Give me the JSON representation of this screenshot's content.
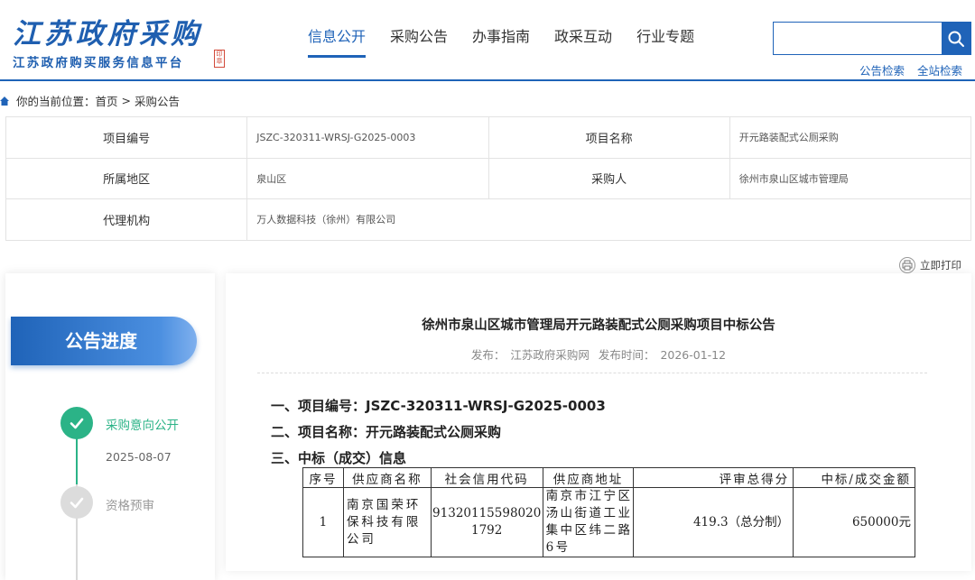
{
  "logo": {
    "calligraphy": "江苏政府采购",
    "subtitle": "江苏政府购买服务信息平台",
    "seal": "印章"
  },
  "nav": [
    "信息公开",
    "采购公告",
    "办事指南",
    "政采互动",
    "行业专题"
  ],
  "search": {
    "placeholder": "",
    "links": [
      "公告检索",
      "全站检索"
    ]
  },
  "breadcrumb": {
    "prefix": "你的当前位置：",
    "home": "首页",
    "separator": ">",
    "current": "采购公告"
  },
  "info": {
    "rows": [
      [
        {
          "label": "项目编号",
          "value": "JSZC-320311-WRSJ-G2025-0003"
        },
        {
          "label": "项目名称",
          "value": "开元路装配式公厕采购"
        }
      ],
      [
        {
          "label": "所属地区",
          "value": "泉山区"
        },
        {
          "label": "采购人",
          "value": "徐州市泉山区城市管理局"
        }
      ],
      [
        {
          "label": "代理机构",
          "value": "万人数据科技（徐州）有限公司"
        }
      ]
    ]
  },
  "print_label": "立即打印",
  "sidebar": {
    "title": "公告进度",
    "steps": [
      {
        "label": "采购意向公开",
        "date": "2025-08-07",
        "done": true,
        "color": "#2bb387"
      },
      {
        "label": "资格预审",
        "date": "",
        "done": false,
        "color": "#999999"
      }
    ]
  },
  "document": {
    "title": "徐州市泉山区城市管理局开元路装配式公厕采购项目中标公告",
    "publisher_label": "发布：",
    "publisher": "江苏政府采购网",
    "time_label": "发布时间：",
    "time": "2026-01-12",
    "sections": [
      "一、项目编号：JSZC-320311-WRSJ-G2025-0003",
      "二、项目名称：开元路装配式公厕采购",
      "三、中标（成交）信息"
    ],
    "table": {
      "headers": [
        "序号",
        "供应商名称",
        "社会信用代码",
        "供应商地址",
        "评审总得分",
        "中标/成交金额"
      ],
      "rows": [
        [
          "1",
          "南京国荣环保科技有限公司",
          "913201155980201792",
          "南京市江宁区汤山街道工业集中区纬二路6号",
          "419.3（总分制）",
          "650000元"
        ]
      ]
    }
  },
  "colors": {
    "primary": "#1f63b8",
    "success": "#2bb387"
  }
}
